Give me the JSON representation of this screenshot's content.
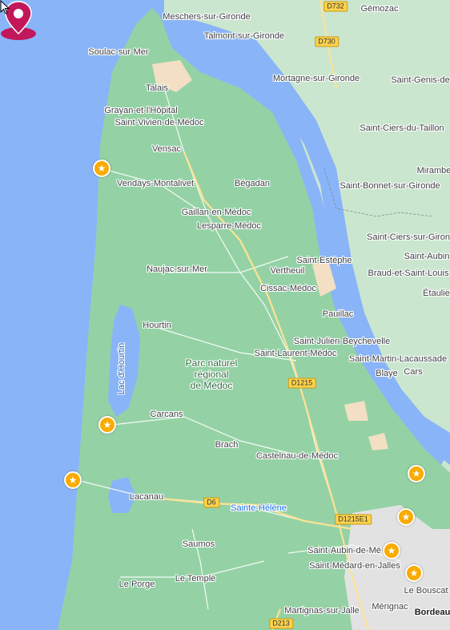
{
  "map": {
    "colors": {
      "water": "#8ab4f8",
      "land": "#94d2a5",
      "east_land": "#cbe6cf",
      "urban": "#e2e2e2",
      "sand": "#f3dfc3",
      "road_major": "#fde293",
      "road_minor": "#ffffff"
    },
    "park_label": "Parc naturel\nrégional\nde Médoc",
    "lake_label": "Lac d'Hourtin",
    "selected_place": "Sainte-Hélène",
    "places": [
      "Meschers-sur-Gironde",
      "Gémozac",
      "Talmont-sur-Gironde",
      "Soulac-sur-Mer",
      "Mortagne-sur-Gironde",
      "Saint-Genis-de",
      "Talais",
      "Grayan-et-l'Hôpital",
      "Saint-Vivien-de-Médoc",
      "Saint-Ciers-du-Taillon",
      "Vensac",
      "Mirambe",
      "Vendays-Montalivet",
      "Bégadan",
      "Saint-Bonnet-sur-Gironde",
      "Gaillan-en-Médoc",
      "Lesparre-Médoc",
      "Saint-Ciers-sur-Giron",
      "Saint-Aubin",
      "Saint-Estèphe",
      "Naujac-sur-Mer",
      "Vertheuil",
      "Braud-et-Saint-Louis",
      "Cissac-Médoc",
      "Étaulie",
      "Pauillac",
      "Hourtin",
      "Saint-Julien-Beychevelle",
      "Saint-Laurent-Médoc",
      "Saint-Martin-Lacaussade",
      "Blaye",
      "Cars",
      "Carcans",
      "Brach",
      "Castelnau-de-Médoc",
      "Lacanau",
      "Saumos",
      "Saint-Aubin-de-Mé",
      "Saint-Médard-en-Jalles",
      "Le Porge",
      "Le Temple",
      "Le Bouscat",
      "Martignas-sur-Jalle",
      "Mérignac",
      "Bordeau"
    ],
    "roads": [
      "D732",
      "D730",
      "D1215",
      "D6",
      "D1215E1",
      "D213"
    ],
    "pin_icon": "location-pin-icon",
    "star_icon": "star-icon"
  }
}
